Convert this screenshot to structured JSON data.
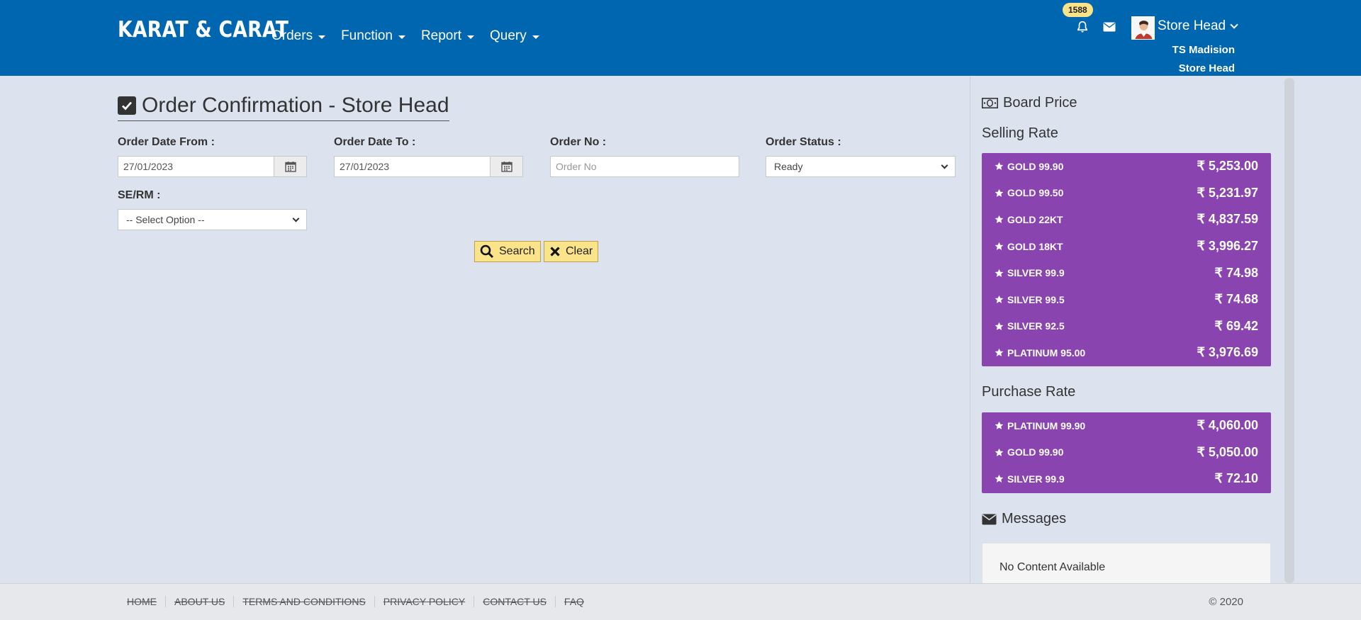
{
  "header": {
    "brand": "KARAT & CARAT",
    "nav": [
      "Orders",
      "Function",
      "Report",
      "Query"
    ],
    "notification_count": "1588",
    "user_role": "Store Head",
    "store_name": "TS Madision",
    "store_role": "Store Head"
  },
  "page": {
    "title": "Order Confirmation - Store Head"
  },
  "form": {
    "date_from_label": "Order Date From :",
    "date_from_value": "27/01/2023",
    "date_to_label": "Order Date To :",
    "date_to_value": "27/01/2023",
    "order_no_label": "Order No :",
    "order_no_placeholder": "Order No",
    "order_status_label": "Order Status :",
    "order_status_value": "Ready",
    "se_rm_label": "SE/RM :",
    "se_rm_value": "-- Select Option --",
    "search_label": "Search",
    "clear_label": "Clear"
  },
  "sidebar": {
    "title": "Board Price",
    "selling_title": "Selling Rate",
    "selling": [
      {
        "name": "GOLD 99.90",
        "value": "₹ 5,253.00"
      },
      {
        "name": "GOLD 99.50",
        "value": "₹ 5,231.97"
      },
      {
        "name": "GOLD 22KT",
        "value": "₹ 4,837.59"
      },
      {
        "name": "GOLD 18KT",
        "value": "₹ 3,996.27"
      },
      {
        "name": "SILVER 99.9",
        "value": "₹ 74.98"
      },
      {
        "name": "SILVER 99.5",
        "value": "₹ 74.68"
      },
      {
        "name": "SILVER 92.5",
        "value": "₹ 69.42"
      },
      {
        "name": "PLATINUM 95.00",
        "value": "₹ 3,976.69"
      }
    ],
    "purchase_title": "Purchase Rate",
    "purchase": [
      {
        "name": "PLATINUM 99.90",
        "value": "₹ 4,060.00"
      },
      {
        "name": "GOLD 99.90",
        "value": "₹ 5,050.00"
      },
      {
        "name": "SILVER 99.9",
        "value": "₹ 72.10"
      }
    ],
    "messages_title": "Messages",
    "messages_empty": "No Content Available"
  },
  "footer": {
    "links": [
      "HOME",
      "ABOUT US",
      "TERMS AND CONDITIONS",
      "PRIVACY POLICY",
      "CONTACT US",
      "FAQ"
    ],
    "copyright": "© 2020"
  },
  "colors": {
    "header_bg": "#0166b0",
    "rate_panel": "#8a44b0",
    "button_bg": "#fbe38a"
  }
}
